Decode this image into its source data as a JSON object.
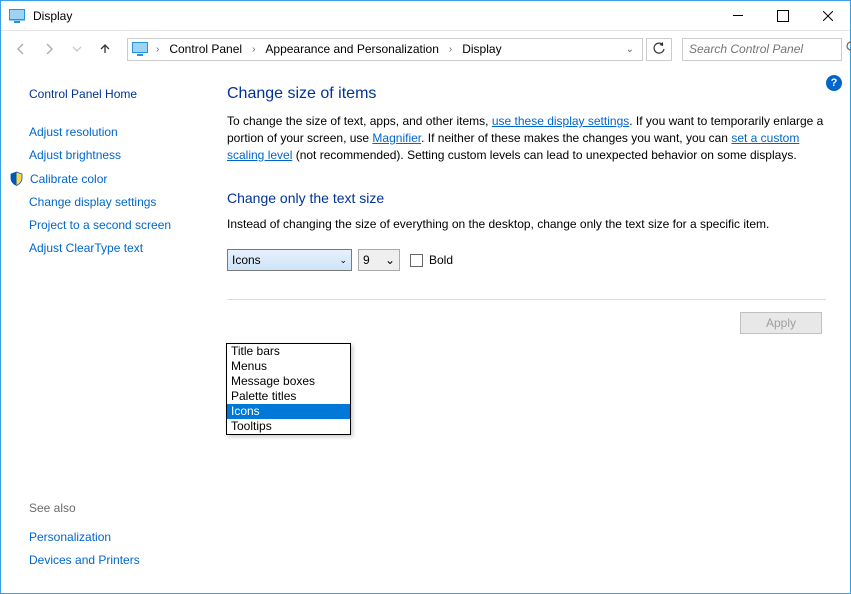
{
  "window": {
    "title": "Display"
  },
  "breadcrumbs": [
    "Control Panel",
    "Appearance and Personalization",
    "Display"
  ],
  "search": {
    "placeholder": "Search Control Panel"
  },
  "sidebar": {
    "home": "Control Panel Home",
    "links": [
      "Adjust resolution",
      "Adjust brightness",
      "Calibrate color",
      "Change display settings",
      "Project to a second screen",
      "Adjust ClearType text"
    ],
    "seealso_label": "See also",
    "seealso": [
      "Personalization",
      "Devices and Printers"
    ]
  },
  "main": {
    "heading1": "Change size of items",
    "para1_a": "To change the size of text, apps, and other items, ",
    "link1": "use these display settings",
    "para1_b": ".  If you want to temporarily enlarge a portion of your screen, use ",
    "link2": "Magnifier",
    "para1_c": ".  If neither of these makes the changes you want, you can ",
    "link3": "set a custom scaling level",
    "para1_d": " (not recommended).  Setting custom levels can lead to unexpected behavior on some displays.",
    "heading2": "Change only the text size",
    "para2": "Instead of changing the size of everything on the desktop, change only the text size for a specific item.",
    "item_select_value": "Icons",
    "size_select_value": "9",
    "bold_label": "Bold",
    "apply_label": "Apply",
    "dropdown_options": [
      "Title bars",
      "Menus",
      "Message boxes",
      "Palette titles",
      "Icons",
      "Tooltips"
    ],
    "dropdown_selected": "Icons"
  }
}
